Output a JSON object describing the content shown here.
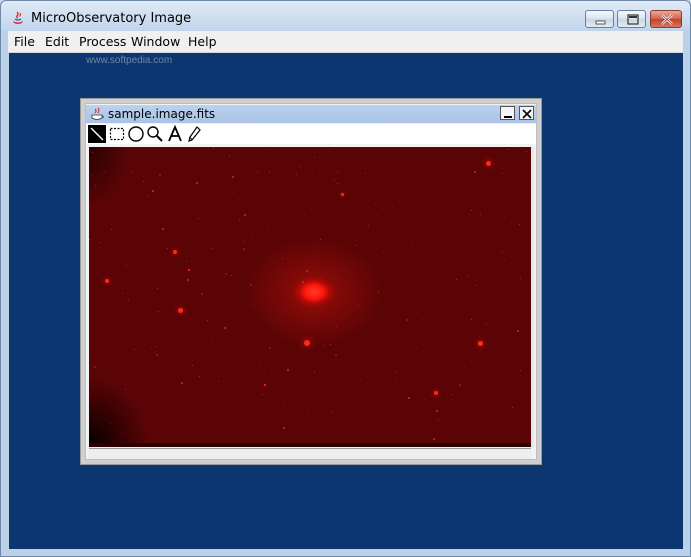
{
  "window": {
    "title": "MicroObservatory Image"
  },
  "menubar": {
    "items": [
      "File",
      "Edit",
      "Process",
      "Window",
      "Help"
    ]
  },
  "watermark": "www.softpedia.com",
  "image_window": {
    "title": "sample.image.fits",
    "tools": [
      "line-tool",
      "rectangle-select-tool",
      "ellipse-select-tool",
      "zoom-tool",
      "text-tool",
      "pencil-tool"
    ]
  },
  "colors": {
    "desktop": "#0c3670",
    "sky": "#5a0406",
    "star": "#ff2010"
  }
}
